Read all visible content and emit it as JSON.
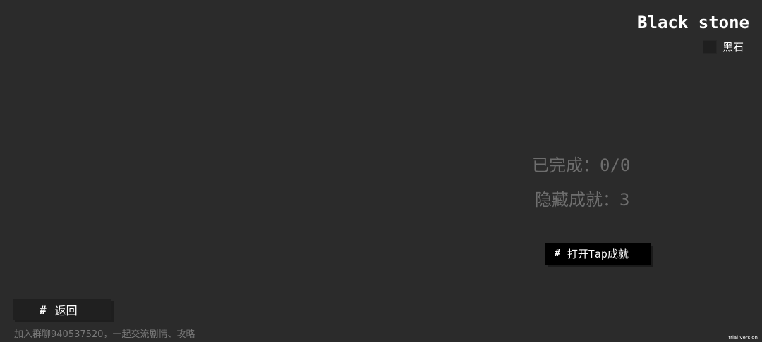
{
  "header": {
    "title": "Black stone",
    "item_label": "黑石"
  },
  "stats": {
    "completed": "已完成：0/0",
    "hidden": "隐藏成就：3"
  },
  "buttons": {
    "tap_icon": "#",
    "tap_label": "打开Tap成就",
    "back_icon": "#",
    "back_label": "返回"
  },
  "footer": {
    "community_text": "加入群聊940537520，一起交流剧情、攻略"
  },
  "watermark": "trial version",
  "colors": {
    "background": "#2b2b2b",
    "stat_text": "#6e6e6e",
    "button_bg": "#000000"
  }
}
